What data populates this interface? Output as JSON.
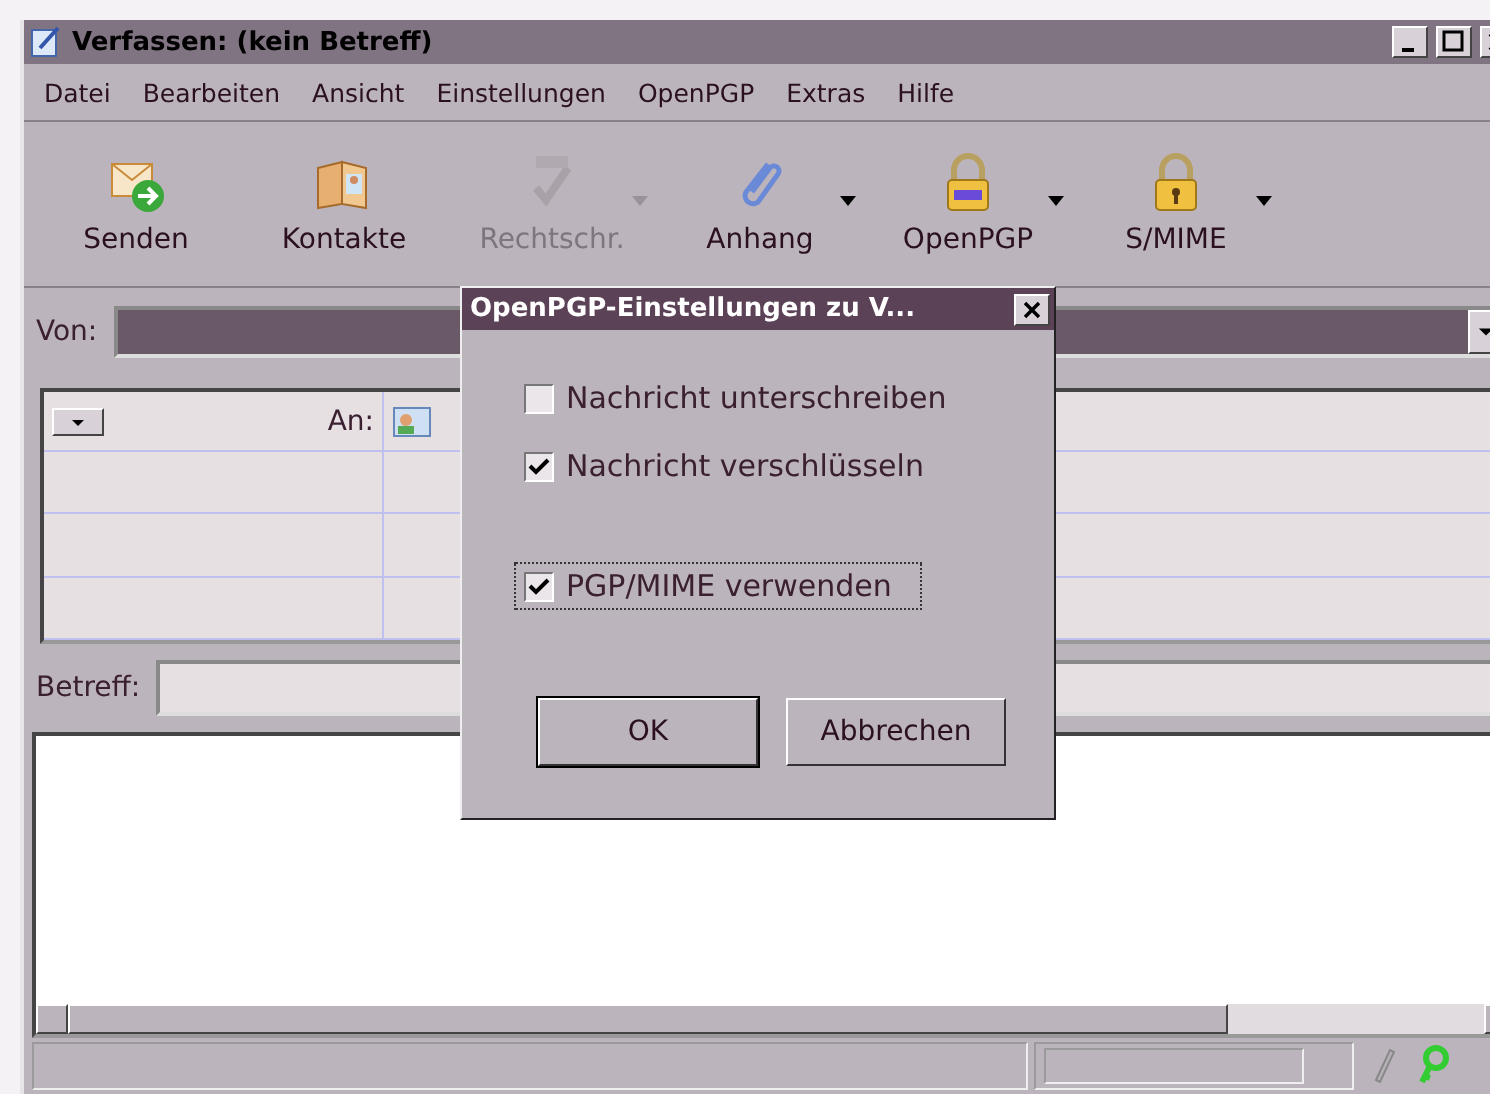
{
  "window": {
    "title": "Verfassen: (kein Betreff)"
  },
  "menu": [
    {
      "label": "Datei"
    },
    {
      "label": "Bearbeiten"
    },
    {
      "label": "Ansicht"
    },
    {
      "label": "Einstellungen"
    },
    {
      "label": "OpenPGP"
    },
    {
      "label": "Extras"
    },
    {
      "label": "Hilfe"
    }
  ],
  "toolbar": [
    {
      "label": "Senden",
      "kind": "send",
      "disabled": false,
      "dropdown": false
    },
    {
      "label": "Kontakte",
      "kind": "contacts",
      "disabled": false,
      "dropdown": false
    },
    {
      "label": "Rechtschr.",
      "kind": "spell",
      "disabled": true,
      "dropdown": true
    },
    {
      "label": "Anhang",
      "kind": "attach",
      "disabled": false,
      "dropdown": true
    },
    {
      "label": "OpenPGP",
      "kind": "pgp",
      "disabled": false,
      "dropdown": true
    },
    {
      "label": "S/MIME",
      "kind": "smime",
      "disabled": false,
      "dropdown": true
    }
  ],
  "from": {
    "label": "Von:"
  },
  "recipients": {
    "type_label": "An:"
  },
  "subject": {
    "label": "Betreff:"
  },
  "dialog": {
    "title": "OpenPGP-Einstellungen zu V...",
    "options": [
      {
        "label": "Nachricht unterschreiben",
        "checked": false,
        "focused": false
      },
      {
        "label": "Nachricht verschlüsseln",
        "checked": true,
        "focused": false
      },
      {
        "label": "PGP/MIME verwenden",
        "checked": true,
        "focused": true
      }
    ],
    "buttons": [
      {
        "label": "OK",
        "default": true
      },
      {
        "label": "Abbrechen",
        "default": false
      }
    ]
  }
}
